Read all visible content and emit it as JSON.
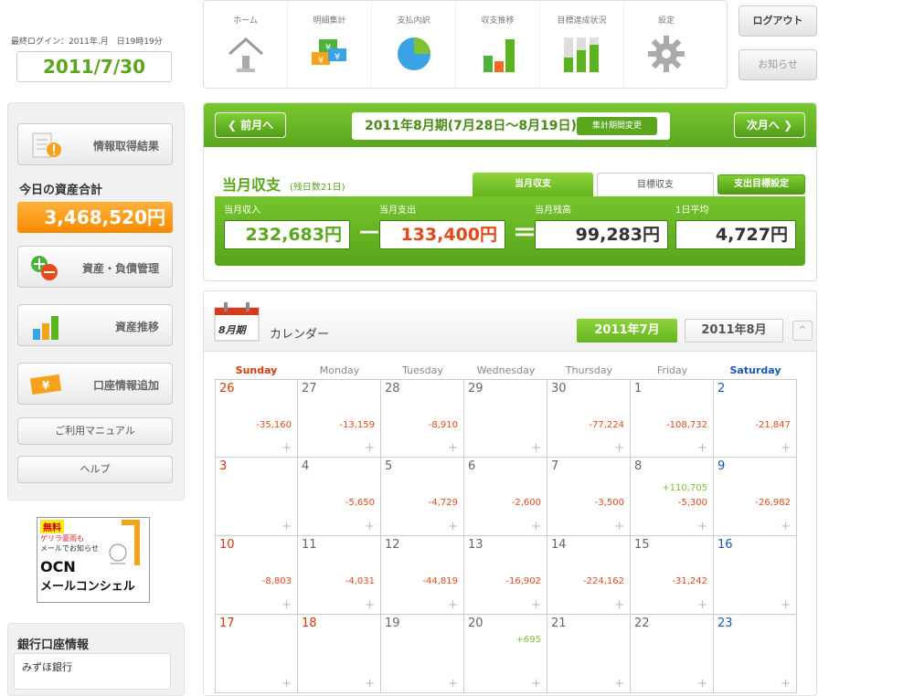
{
  "login": {
    "last_login": "最終ログイン：2011年.月　日19時19分",
    "date": "2011/7/30"
  },
  "side": {
    "info_result": "情報取得結果",
    "asset_title": "今日の資産合計",
    "asset_total": "3,468,520円",
    "asset_mgmt": "資産・負債管理",
    "asset_trend": "資産推移",
    "account_add": "口座情報追加",
    "manual": "ご利用マニュアル",
    "help": "ヘルプ",
    "bank_title": "銀行口座情報",
    "bank_item": "みずほ銀行"
  },
  "ad": {
    "free": "無料",
    "line1": "ゲリラ豪雨も",
    "line2": "メールでお知らせ",
    "brand": "OCN",
    "product": "メールコンシェル"
  },
  "nav": {
    "items": [
      {
        "label": "ホーム",
        "icon": "home-icon"
      },
      {
        "label": "明細集計",
        "icon": "yen-bills-icon"
      },
      {
        "label": "支払内訳",
        "icon": "pie-chart-icon"
      },
      {
        "label": "収支推移",
        "icon": "bar-chart-icon"
      },
      {
        "label": "目標達成状況",
        "icon": "goal-bars-icon"
      },
      {
        "label": "設定",
        "icon": "gear-icon"
      }
    ],
    "logout": "ログアウト",
    "notice": "お知らせ"
  },
  "period": {
    "prev": "前月へ",
    "title": "2011年8月期(7月28日〜8月19日)",
    "change": "集計期間変更",
    "next": "次月へ"
  },
  "summary": {
    "title": "当月収支",
    "remaining_days": "(残日数21日)",
    "tab_actual": "当月収支",
    "tab_target": "目標収支",
    "set_target": "支出目標設定",
    "income_label": "当月収入",
    "income": "232,683円",
    "expense_label": "当月支出",
    "expense": "133,400円",
    "balance_label": "当月残高",
    "balance": "99,283円",
    "daily_label": "1日平均",
    "daily": "4,727円",
    "minus": "－",
    "equals": "＝"
  },
  "calendar": {
    "icon_text": "8月期",
    "title": "カレンダー",
    "month_current": "2011年7月",
    "month_next": "2011年8月",
    "collapse": "^",
    "days_of_week": [
      "Sunday",
      "Monday",
      "Tuesday",
      "Wednesday",
      "Thursday",
      "Friday",
      "Saturday"
    ],
    "colors": {
      "sunday": "#d33a0a",
      "saturday": "#1a56b8",
      "expense": "#e24a1a",
      "income": "#7cc234"
    },
    "weeks": [
      [
        {
          "day": "26",
          "expense": "-35,160",
          "income": ""
        },
        {
          "day": "27",
          "expense": "-13,159",
          "income": ""
        },
        {
          "day": "28",
          "expense": "-8,910",
          "income": ""
        },
        {
          "day": "29",
          "expense": "",
          "income": ""
        },
        {
          "day": "30",
          "expense": "-77,224",
          "income": ""
        },
        {
          "day": "1",
          "expense": "-108,732",
          "income": ""
        },
        {
          "day": "2",
          "expense": "-21,847",
          "income": ""
        }
      ],
      [
        {
          "day": "3",
          "expense": "",
          "income": ""
        },
        {
          "day": "4",
          "expense": "-5,650",
          "income": ""
        },
        {
          "day": "5",
          "expense": "-4,729",
          "income": ""
        },
        {
          "day": "6",
          "expense": "-2,600",
          "income": ""
        },
        {
          "day": "7",
          "expense": "-3,500",
          "income": ""
        },
        {
          "day": "8",
          "expense": "-5,300",
          "income": "+110,705"
        },
        {
          "day": "9",
          "expense": "-26,982",
          "income": ""
        }
      ],
      [
        {
          "day": "10",
          "expense": "-8,803",
          "income": ""
        },
        {
          "day": "11",
          "expense": "-4,031",
          "income": ""
        },
        {
          "day": "12",
          "expense": "-44,819",
          "income": ""
        },
        {
          "day": "13",
          "expense": "-16,902",
          "income": ""
        },
        {
          "day": "14",
          "expense": "-224,162",
          "income": ""
        },
        {
          "day": "15",
          "expense": "-31,242",
          "income": ""
        },
        {
          "day": "16",
          "expense": "",
          "income": ""
        }
      ],
      [
        {
          "day": "17",
          "expense": "",
          "income": ""
        },
        {
          "day": "18",
          "expense": "",
          "income": ""
        },
        {
          "day": "19",
          "expense": "",
          "income": ""
        },
        {
          "day": "20",
          "expense": "",
          "income": "+695"
        },
        {
          "day": "21",
          "expense": "",
          "income": ""
        },
        {
          "day": "22",
          "expense": "",
          "income": ""
        },
        {
          "day": "23",
          "expense": "",
          "income": ""
        }
      ]
    ],
    "add_symbol": "+"
  }
}
